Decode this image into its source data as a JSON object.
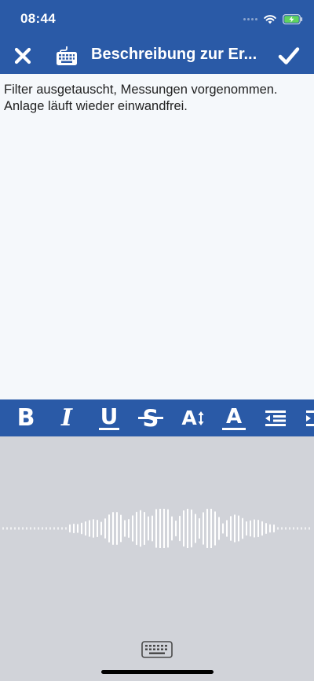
{
  "status_bar": {
    "time": "08:44"
  },
  "nav": {
    "close_icon": "close-icon",
    "keyboard_icon": "keyboard-icon",
    "title": "Beschreibung zur Er...",
    "done_icon": "checkmark-icon"
  },
  "editor": {
    "text": "Filter ausgetauscht, Messungen vorgenommen.\nAnlage läuft wieder einwandfrei."
  },
  "format_toolbar": {
    "bold": "B",
    "italic": "I",
    "underline": "U",
    "strikethrough": "S",
    "font_size": "A",
    "font_color": "A",
    "outdent_icon": "outdent-icon",
    "indent_icon": "indent-icon"
  },
  "dictation": {
    "waveform_icon": "dictation-waveform",
    "keyboard_switch_icon": "keyboard-icon"
  },
  "colors": {
    "brand_blue": "#2a5aa7",
    "editor_bg": "#f5f8fb",
    "dictation_bg": "#d1d3d9"
  }
}
